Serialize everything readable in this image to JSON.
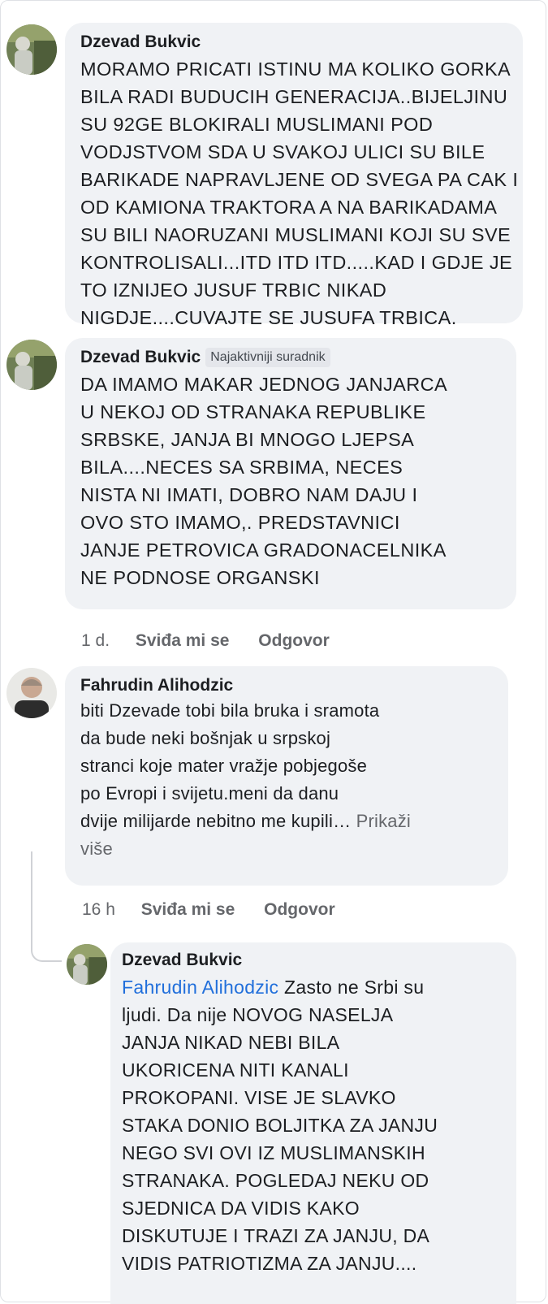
{
  "comments": [
    {
      "author": "Dzevad Bukvic",
      "lines": [
        "MORAMO PRICATI ISTINU MA KOLIKO GORKA",
        "BILA RADI BUDUCIH GENERACIJA..BIJELJINU",
        "SU 92GE BLOKIRALI MUSLIMANI POD",
        "VODJSTVOM SDA U SVAKOJ ULICI SU BILE",
        "BARIKADE NAPRAVLJENE OD SVEGA PA CAK I",
        "OD KAMIONA TRAKTORA A NA BARIKADAMA",
        "SU BILI NAORUZANI MUSLIMANI KOJI SU SVE",
        "KONTROLISALI...ITD ITD ITD.....KAD I GDJE JE",
        "TO IZNIJEO JUSUF TRBIC NIKAD",
        "NIGDJE....CUVAJTE SE JUSUFA TRBICA."
      ]
    },
    {
      "author": "Dzevad Bukvic",
      "badge": "Najaktivniji suradnik",
      "lines": [
        "DA IMAMO MAKAR JEDNOG JANJARCA",
        "U NEKOJ OD STRANAKA REPUBLIKE",
        "SRBSKE, JANJA BI MNOGO LJEPSA",
        "BILA....NECES SA SRBIMA, NECES",
        "NISTA NI IMATI, DOBRO NAM DAJU I",
        "OVO STO IMAMO,. PREDSTAVNICI",
        "JANJE PETROVICA GRADONACELNIKA",
        "NE PODNOSE ORGANSKI"
      ],
      "time": "1 d.",
      "like": "Sviđa mi se",
      "reply": "Odgovor"
    },
    {
      "author": "Fahrudin Alihodzic",
      "lines": [
        "biti Dzevade tobi bila bruka i sramota",
        "da bude neki bošnjak u srpskoj",
        "stranci koje mater vražje pobjegoše",
        "po Evropi i svijetu.meni da danu",
        "dvije milijarde nebitno me kupili…"
      ],
      "see_more_a": "Prikaži",
      "see_more_b": "više",
      "time": "16 h",
      "like": "Sviđa mi se",
      "reply": "Odgovor"
    },
    {
      "author": "Dzevad Bukvic",
      "mention": "Fahrudin Alihodzic",
      "first_line_rest": "Zasto ne Srbi su",
      "lines": [
        "ljudi. Da nije NOVOG NASELJA",
        "JANJA NIKAD NEBI BILA",
        "UKORICENA NITI KANALI",
        "PROKOPANI. VISE JE SLAVKO",
        "STAKA DONIO BOLJITKA ZA JANJU",
        "NEGO SVI OVI IZ MUSLIMANSKIH",
        "STRANAKA. POGLEDAJ NEKU OD",
        "SJEDNICA DA VIDIS KAKO",
        "DISKUTUJE I TRAZI ZA JANJU, DA",
        "VIDIS PATRIOTIZMA ZA JANJU...."
      ]
    }
  ]
}
